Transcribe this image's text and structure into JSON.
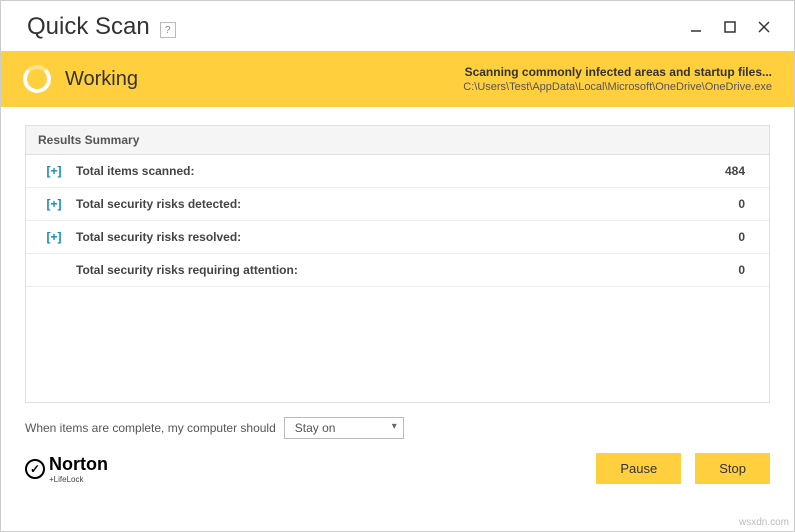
{
  "window": {
    "title": "Quick Scan",
    "help": "?"
  },
  "status": {
    "label": "Working",
    "heading": "Scanning commonly infected areas and startup files...",
    "path": "C:\\Users\\Test\\AppData\\Local\\Microsoft\\OneDrive\\OneDrive.exe"
  },
  "results": {
    "title": "Results Summary",
    "rows": [
      {
        "expand": "[+]",
        "label": "Total items scanned:",
        "value": "484"
      },
      {
        "expand": "[+]",
        "label": "Total security risks detected:",
        "value": "0"
      },
      {
        "expand": "[+]",
        "label": "Total security risks resolved:",
        "value": "0"
      },
      {
        "expand": "",
        "label": "Total security risks requiring attention:",
        "value": "0"
      }
    ]
  },
  "completion": {
    "prompt": "When items are complete, my computer should",
    "selected": "Stay on"
  },
  "branding": {
    "name": "Norton",
    "sub": "+LifeLock"
  },
  "buttons": {
    "pause": "Pause",
    "stop": "Stop"
  },
  "watermark": "wsxdn.com"
}
